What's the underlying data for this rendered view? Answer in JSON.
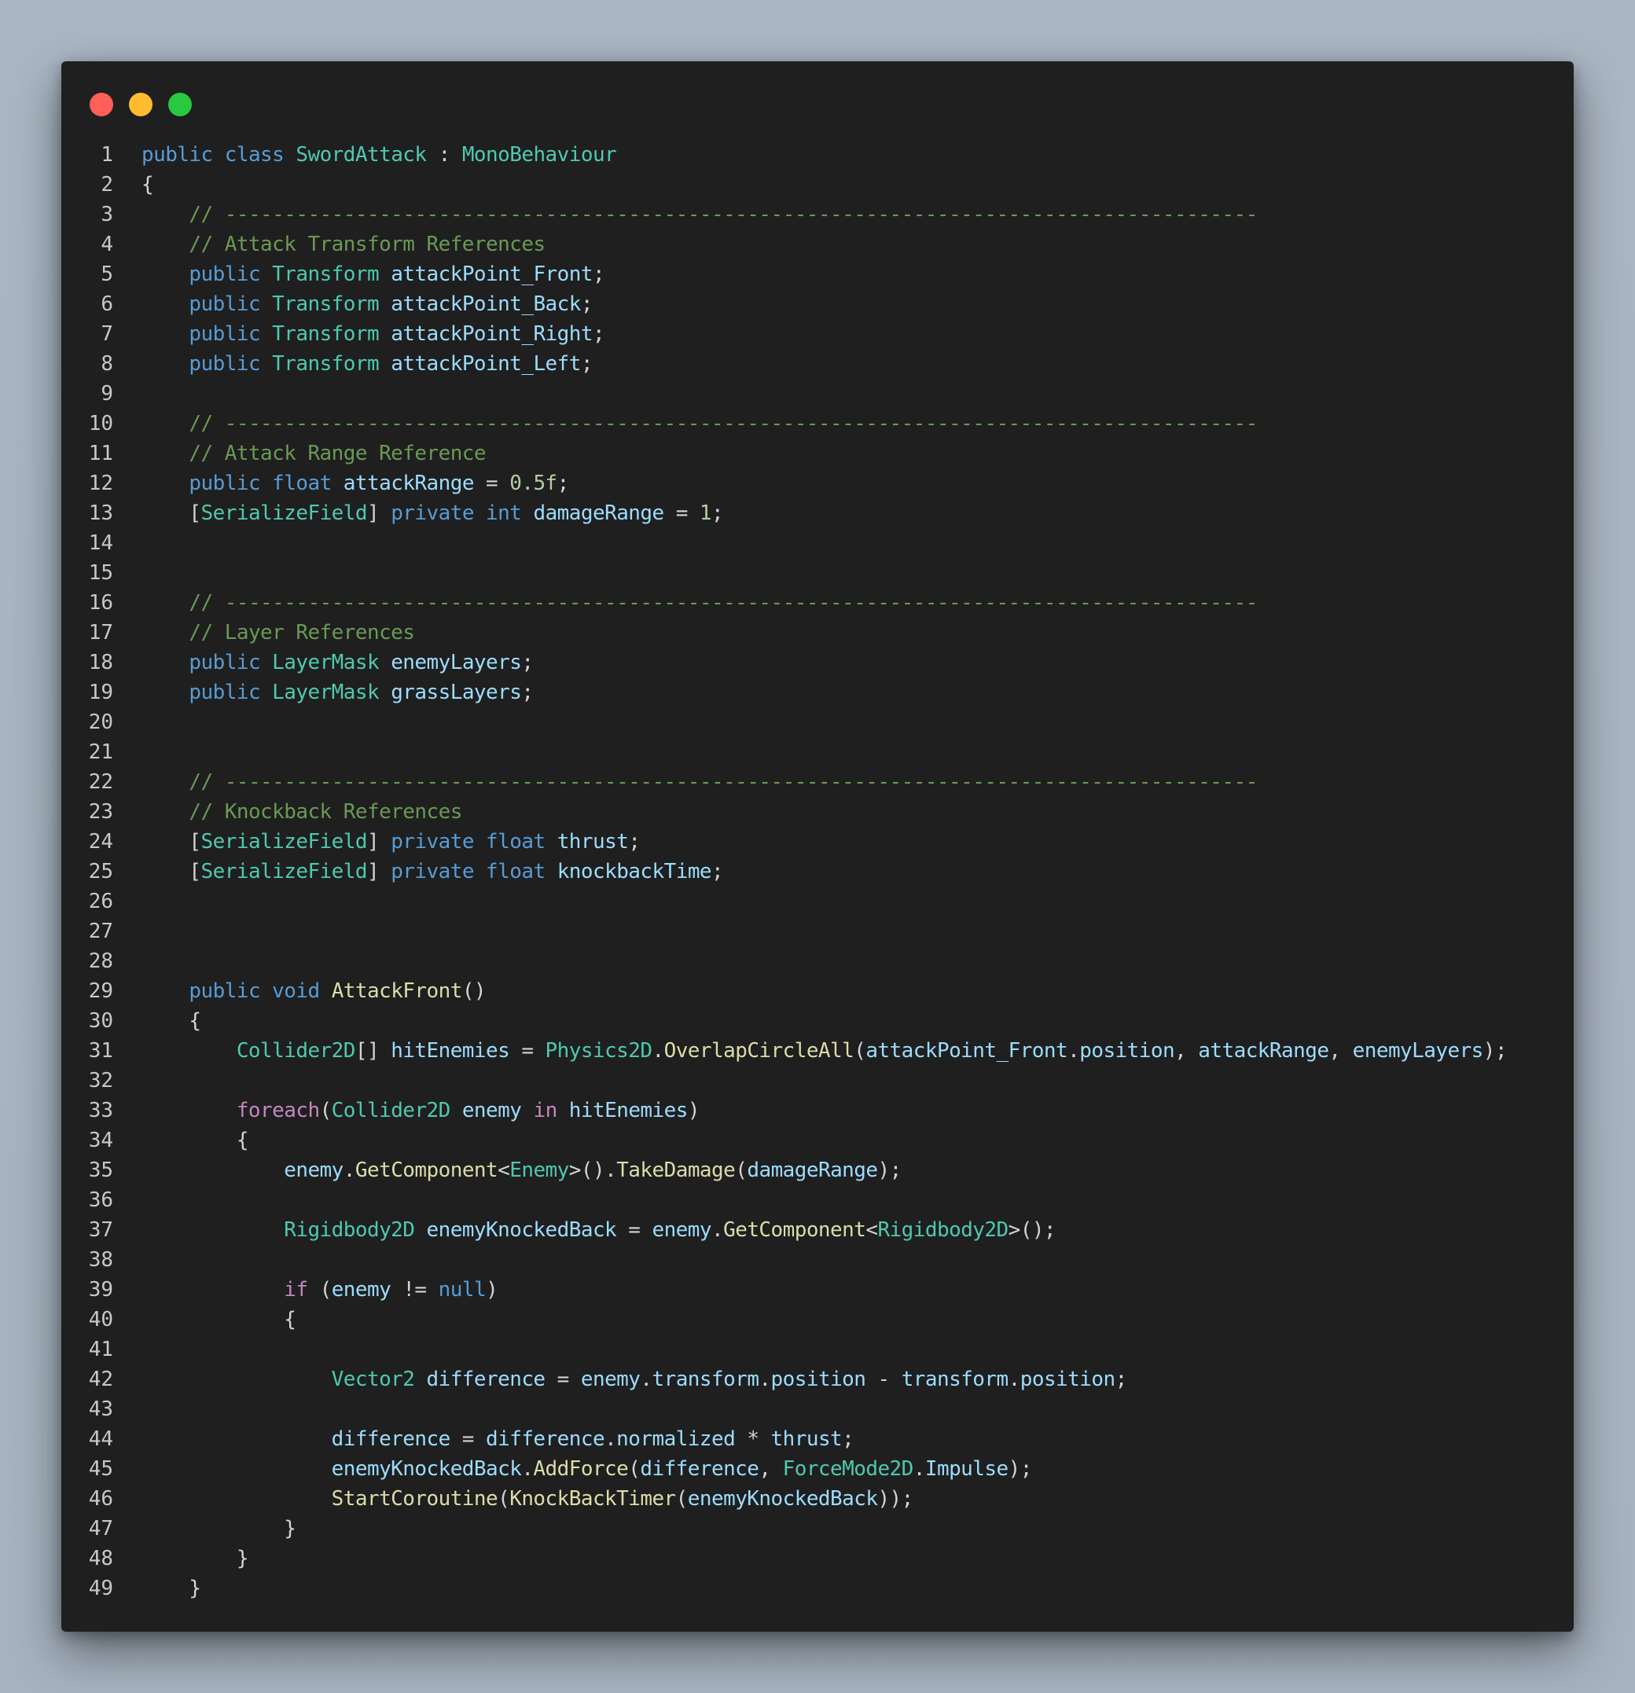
{
  "colors": {
    "close": "#ff5f57",
    "minimize": "#febc2e",
    "zoom": "#28c840",
    "window_background": "#1f1f1f"
  },
  "window_controls": [
    "close-dot",
    "minimize-dot",
    "zoom-dot"
  ],
  "lines": [
    {
      "n": "1",
      "tokens": [
        [
          "kw",
          "public"
        ],
        [
          "plain",
          " "
        ],
        [
          "kw",
          "class"
        ],
        [
          "plain",
          " "
        ],
        [
          "type",
          "SwordAttack"
        ],
        [
          "plain",
          " : "
        ],
        [
          "type",
          "MonoBehaviour"
        ]
      ]
    },
    {
      "n": "2",
      "tokens": [
        [
          "plain",
          "{"
        ]
      ]
    },
    {
      "n": "3",
      "tokens": [
        [
          "plain",
          "    "
        ],
        [
          "com",
          "// ---------------------------------------------------------------------------------------"
        ]
      ]
    },
    {
      "n": "4",
      "tokens": [
        [
          "plain",
          "    "
        ],
        [
          "com",
          "// Attack Transform References"
        ]
      ]
    },
    {
      "n": "5",
      "tokens": [
        [
          "plain",
          "    "
        ],
        [
          "kw",
          "public"
        ],
        [
          "plain",
          " "
        ],
        [
          "type",
          "Transform"
        ],
        [
          "plain",
          " "
        ],
        [
          "var",
          "attackPoint_Front"
        ],
        [
          "plain",
          ";"
        ]
      ]
    },
    {
      "n": "6",
      "tokens": [
        [
          "plain",
          "    "
        ],
        [
          "kw",
          "public"
        ],
        [
          "plain",
          " "
        ],
        [
          "type",
          "Transform"
        ],
        [
          "plain",
          " "
        ],
        [
          "var",
          "attackPoint_Back"
        ],
        [
          "plain",
          ";"
        ]
      ]
    },
    {
      "n": "7",
      "tokens": [
        [
          "plain",
          "    "
        ],
        [
          "kw",
          "public"
        ],
        [
          "plain",
          " "
        ],
        [
          "type",
          "Transform"
        ],
        [
          "plain",
          " "
        ],
        [
          "var",
          "attackPoint_Right"
        ],
        [
          "plain",
          ";"
        ]
      ]
    },
    {
      "n": "8",
      "tokens": [
        [
          "plain",
          "    "
        ],
        [
          "kw",
          "public"
        ],
        [
          "plain",
          " "
        ],
        [
          "type",
          "Transform"
        ],
        [
          "plain",
          " "
        ],
        [
          "var",
          "attackPoint_Left"
        ],
        [
          "plain",
          ";"
        ]
      ]
    },
    {
      "n": "9",
      "tokens": []
    },
    {
      "n": "10",
      "tokens": [
        [
          "plain",
          "    "
        ],
        [
          "com",
          "// ---------------------------------------------------------------------------------------"
        ]
      ]
    },
    {
      "n": "11",
      "tokens": [
        [
          "plain",
          "    "
        ],
        [
          "com",
          "// Attack Range Reference"
        ]
      ]
    },
    {
      "n": "12",
      "tokens": [
        [
          "plain",
          "    "
        ],
        [
          "kw",
          "public"
        ],
        [
          "plain",
          " "
        ],
        [
          "kw",
          "float"
        ],
        [
          "plain",
          " "
        ],
        [
          "var",
          "attackRange"
        ],
        [
          "plain",
          " = "
        ],
        [
          "num",
          "0.5f"
        ],
        [
          "plain",
          ";"
        ]
      ]
    },
    {
      "n": "13",
      "tokens": [
        [
          "plain",
          "    ["
        ],
        [
          "type",
          "SerializeField"
        ],
        [
          "plain",
          "] "
        ],
        [
          "kw",
          "private"
        ],
        [
          "plain",
          " "
        ],
        [
          "kw",
          "int"
        ],
        [
          "plain",
          " "
        ],
        [
          "var",
          "damageRange"
        ],
        [
          "plain",
          " = "
        ],
        [
          "num",
          "1"
        ],
        [
          "plain",
          ";"
        ]
      ]
    },
    {
      "n": "14",
      "tokens": []
    },
    {
      "n": "15",
      "tokens": []
    },
    {
      "n": "16",
      "tokens": [
        [
          "plain",
          "    "
        ],
        [
          "com",
          "// ---------------------------------------------------------------------------------------"
        ]
      ]
    },
    {
      "n": "17",
      "tokens": [
        [
          "plain",
          "    "
        ],
        [
          "com",
          "// Layer References"
        ]
      ]
    },
    {
      "n": "18",
      "tokens": [
        [
          "plain",
          "    "
        ],
        [
          "kw",
          "public"
        ],
        [
          "plain",
          " "
        ],
        [
          "type",
          "LayerMask"
        ],
        [
          "plain",
          " "
        ],
        [
          "var",
          "enemyLayers"
        ],
        [
          "plain",
          ";"
        ]
      ]
    },
    {
      "n": "19",
      "tokens": [
        [
          "plain",
          "    "
        ],
        [
          "kw",
          "public"
        ],
        [
          "plain",
          " "
        ],
        [
          "type",
          "LayerMask"
        ],
        [
          "plain",
          " "
        ],
        [
          "var",
          "grassLayers"
        ],
        [
          "plain",
          ";"
        ]
      ]
    },
    {
      "n": "20",
      "tokens": []
    },
    {
      "n": "21",
      "tokens": []
    },
    {
      "n": "22",
      "tokens": [
        [
          "plain",
          "    "
        ],
        [
          "com",
          "// ---------------------------------------------------------------------------------------"
        ]
      ]
    },
    {
      "n": "23",
      "tokens": [
        [
          "plain",
          "    "
        ],
        [
          "com",
          "// Knockback References"
        ]
      ]
    },
    {
      "n": "24",
      "tokens": [
        [
          "plain",
          "    ["
        ],
        [
          "type",
          "SerializeField"
        ],
        [
          "plain",
          "] "
        ],
        [
          "kw",
          "private"
        ],
        [
          "plain",
          " "
        ],
        [
          "kw",
          "float"
        ],
        [
          "plain",
          " "
        ],
        [
          "var",
          "thrust"
        ],
        [
          "plain",
          ";"
        ]
      ]
    },
    {
      "n": "25",
      "tokens": [
        [
          "plain",
          "    ["
        ],
        [
          "type",
          "SerializeField"
        ],
        [
          "plain",
          "] "
        ],
        [
          "kw",
          "private"
        ],
        [
          "plain",
          " "
        ],
        [
          "kw",
          "float"
        ],
        [
          "plain",
          " "
        ],
        [
          "var",
          "knockbackTime"
        ],
        [
          "plain",
          ";"
        ]
      ]
    },
    {
      "n": "26",
      "tokens": []
    },
    {
      "n": "27",
      "tokens": []
    },
    {
      "n": "28",
      "tokens": []
    },
    {
      "n": "29",
      "tokens": [
        [
          "plain",
          "    "
        ],
        [
          "kw",
          "public"
        ],
        [
          "plain",
          " "
        ],
        [
          "kw",
          "void"
        ],
        [
          "plain",
          " "
        ],
        [
          "fn",
          "AttackFront"
        ],
        [
          "plain",
          "()"
        ]
      ]
    },
    {
      "n": "30",
      "tokens": [
        [
          "plain",
          "    {"
        ]
      ]
    },
    {
      "n": "31",
      "tokens": [
        [
          "plain",
          "        "
        ],
        [
          "type",
          "Collider2D"
        ],
        [
          "plain",
          "[] "
        ],
        [
          "var",
          "hitEnemies"
        ],
        [
          "plain",
          " = "
        ],
        [
          "type",
          "Physics2D"
        ],
        [
          "plain",
          "."
        ],
        [
          "fn",
          "OverlapCircleAll"
        ],
        [
          "plain",
          "("
        ],
        [
          "var",
          "attackPoint_Front"
        ],
        [
          "plain",
          "."
        ],
        [
          "var",
          "position"
        ],
        [
          "plain",
          ", "
        ],
        [
          "var",
          "attackRange"
        ],
        [
          "plain",
          ", "
        ],
        [
          "var",
          "enemyLayers"
        ],
        [
          "plain",
          ");"
        ]
      ]
    },
    {
      "n": "32",
      "tokens": []
    },
    {
      "n": "33",
      "tokens": [
        [
          "plain",
          "        "
        ],
        [
          "ctl",
          "foreach"
        ],
        [
          "plain",
          "("
        ],
        [
          "type",
          "Collider2D"
        ],
        [
          "plain",
          " "
        ],
        [
          "var",
          "enemy"
        ],
        [
          "plain",
          " "
        ],
        [
          "ctl",
          "in"
        ],
        [
          "plain",
          " "
        ],
        [
          "var",
          "hitEnemies"
        ],
        [
          "plain",
          ")"
        ]
      ]
    },
    {
      "n": "34",
      "tokens": [
        [
          "plain",
          "        {"
        ]
      ]
    },
    {
      "n": "35",
      "tokens": [
        [
          "plain",
          "            "
        ],
        [
          "var",
          "enemy"
        ],
        [
          "plain",
          "."
        ],
        [
          "fn",
          "GetComponent"
        ],
        [
          "plain",
          "<"
        ],
        [
          "type",
          "Enemy"
        ],
        [
          "plain",
          ">()."
        ],
        [
          "fn",
          "TakeDamage"
        ],
        [
          "plain",
          "("
        ],
        [
          "var",
          "damageRange"
        ],
        [
          "plain",
          ");"
        ]
      ]
    },
    {
      "n": "36",
      "tokens": []
    },
    {
      "n": "37",
      "tokens": [
        [
          "plain",
          "            "
        ],
        [
          "type",
          "Rigidbody2D"
        ],
        [
          "plain",
          " "
        ],
        [
          "var",
          "enemyKnockedBack"
        ],
        [
          "plain",
          " = "
        ],
        [
          "var",
          "enemy"
        ],
        [
          "plain",
          "."
        ],
        [
          "fn",
          "GetComponent"
        ],
        [
          "plain",
          "<"
        ],
        [
          "type",
          "Rigidbody2D"
        ],
        [
          "plain",
          ">();"
        ]
      ]
    },
    {
      "n": "38",
      "tokens": []
    },
    {
      "n": "39",
      "tokens": [
        [
          "plain",
          "            "
        ],
        [
          "ctl",
          "if"
        ],
        [
          "plain",
          " ("
        ],
        [
          "var",
          "enemy"
        ],
        [
          "plain",
          " != "
        ],
        [
          "kw",
          "null"
        ],
        [
          "plain",
          ")"
        ]
      ]
    },
    {
      "n": "40",
      "tokens": [
        [
          "plain",
          "            {"
        ]
      ]
    },
    {
      "n": "41",
      "tokens": []
    },
    {
      "n": "42",
      "tokens": [
        [
          "plain",
          "                "
        ],
        [
          "type",
          "Vector2"
        ],
        [
          "plain",
          " "
        ],
        [
          "var",
          "difference"
        ],
        [
          "plain",
          " = "
        ],
        [
          "var",
          "enemy"
        ],
        [
          "plain",
          "."
        ],
        [
          "var",
          "transform"
        ],
        [
          "plain",
          "."
        ],
        [
          "var",
          "position"
        ],
        [
          "plain",
          " - "
        ],
        [
          "var",
          "transform"
        ],
        [
          "plain",
          "."
        ],
        [
          "var",
          "position"
        ],
        [
          "plain",
          ";"
        ]
      ]
    },
    {
      "n": "43",
      "tokens": []
    },
    {
      "n": "44",
      "tokens": [
        [
          "plain",
          "                "
        ],
        [
          "var",
          "difference"
        ],
        [
          "plain",
          " = "
        ],
        [
          "var",
          "difference"
        ],
        [
          "plain",
          "."
        ],
        [
          "var",
          "normalized"
        ],
        [
          "plain",
          " * "
        ],
        [
          "var",
          "thrust"
        ],
        [
          "plain",
          ";"
        ]
      ]
    },
    {
      "n": "45",
      "tokens": [
        [
          "plain",
          "                "
        ],
        [
          "var",
          "enemyKnockedBack"
        ],
        [
          "plain",
          "."
        ],
        [
          "fn",
          "AddForce"
        ],
        [
          "plain",
          "("
        ],
        [
          "var",
          "difference"
        ],
        [
          "plain",
          ", "
        ],
        [
          "type",
          "ForceMode2D"
        ],
        [
          "plain",
          "."
        ],
        [
          "var",
          "Impulse"
        ],
        [
          "plain",
          ");"
        ]
      ]
    },
    {
      "n": "46",
      "tokens": [
        [
          "plain",
          "                "
        ],
        [
          "fn",
          "StartCoroutine"
        ],
        [
          "plain",
          "("
        ],
        [
          "fn",
          "KnockBackTimer"
        ],
        [
          "plain",
          "("
        ],
        [
          "var",
          "enemyKnockedBack"
        ],
        [
          "plain",
          "));"
        ]
      ]
    },
    {
      "n": "47",
      "tokens": [
        [
          "plain",
          "            }"
        ]
      ]
    },
    {
      "n": "48",
      "tokens": [
        [
          "plain",
          "        }"
        ]
      ]
    },
    {
      "n": "49",
      "tokens": [
        [
          "plain",
          "    }"
        ]
      ]
    }
  ]
}
